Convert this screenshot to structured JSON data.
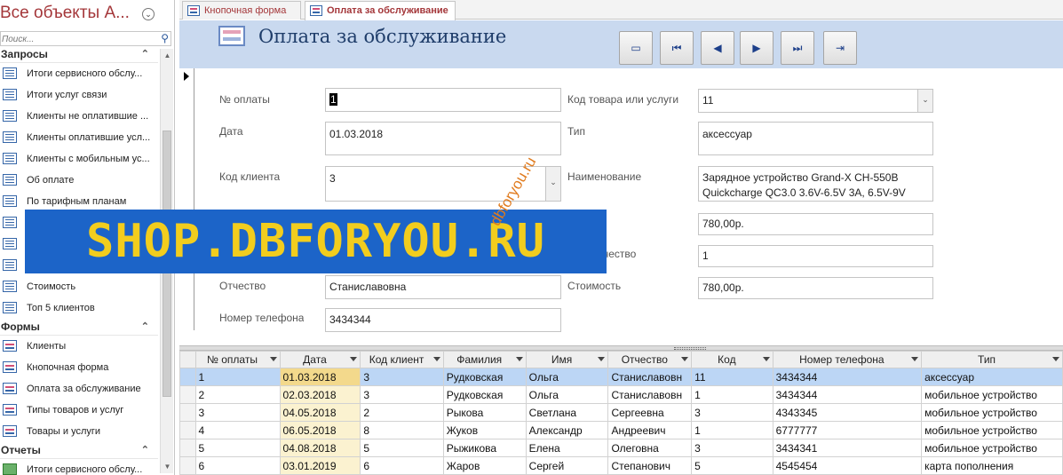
{
  "nav": {
    "title": "Все объекты А...",
    "search_placeholder": "Поиск...",
    "groups": [
      {
        "label": "Запросы",
        "items": [
          "Итоги сервисного обслу...",
          "Итоги услуг связи",
          "Клиенты не оплатившие ...",
          "Клиенты оплатившие усл...",
          "Клиенты с мобильным ус...",
          "Об оплате",
          "По тарифным планам",
          "",
          "",
          "",
          "Стоимость",
          "Топ 5 клиентов"
        ]
      },
      {
        "label": "Формы",
        "items": [
          "Клиенты",
          "Кнопочная форма",
          "Оплата за обслуживание",
          "Типы товаров и услуг",
          "Товары и услуги"
        ]
      },
      {
        "label": "Отчеты",
        "items": [
          "Итоги сервисного обслу..."
        ]
      }
    ]
  },
  "tabs": [
    {
      "label": "Кнопочная форма"
    },
    {
      "label": "Оплата за обслуживание"
    }
  ],
  "form": {
    "title": "Оплата за обслуживание",
    "fields": {
      "payment_no": {
        "label": "№ оплаты",
        "value": "1"
      },
      "date": {
        "label": "Дата",
        "value": "01.03.2018"
      },
      "client_code": {
        "label": "Код клиента",
        "value": "3"
      },
      "patronymic": {
        "label": "Отчество",
        "value": "Станиславовна"
      },
      "phone": {
        "label": "Номер телефона",
        "value": "3434344"
      },
      "product_code": {
        "label": "Код товара или услуги",
        "value": "11"
      },
      "type": {
        "label": "Тип",
        "value": "аксессуар"
      },
      "name": {
        "label": "Наименование",
        "value": "Зарядное устройство Grand-X CH-550B Quickcharge QC3.0 3.6V-6.5V 3A, 6.5V-9V"
      },
      "price": {
        "label": "",
        "value": "780,00р."
      },
      "quantity": {
        "label": "чество",
        "value": "1"
      },
      "cost": {
        "label": "Стоимость",
        "value": "780,00р."
      }
    }
  },
  "watermark": {
    "banner": "SHOP.DBFORYOU.RU",
    "diagonal": "dbforyou.ru"
  },
  "datasheet": {
    "columns": [
      "№ оплаты",
      "Дата",
      "Код клиент",
      "Фамилия",
      "Имя",
      "Отчество",
      "Код",
      "Номер телефона",
      "Тип"
    ],
    "rows": [
      [
        "1",
        "01.03.2018",
        "3",
        "Рудковская",
        "Ольга",
        "Станиславовн",
        "11",
        "3434344",
        "аксессуар"
      ],
      [
        "2",
        "02.03.2018",
        "3",
        "Рудковская",
        "Ольга",
        "Станиславовн",
        "1",
        "3434344",
        "мобильное устройство"
      ],
      [
        "3",
        "04.05.2018",
        "2",
        "Рыкова",
        "Светлана",
        "Сергеевна",
        "3",
        "4343345",
        "мобильное устройство"
      ],
      [
        "4",
        "06.05.2018",
        "8",
        "Жуков",
        "Александр",
        "Андреевич",
        "1",
        "6777777",
        "мобильное устройство"
      ],
      [
        "5",
        "04.08.2018",
        "5",
        "Рыжикова",
        "Елена",
        "Олеговна",
        "3",
        "3434341",
        "мобильное устройство"
      ],
      [
        "6",
        "03.01.2019",
        "6",
        "Жаров",
        "Сергей",
        "Степанович",
        "5",
        "4545454",
        "карта пополнения"
      ]
    ]
  }
}
